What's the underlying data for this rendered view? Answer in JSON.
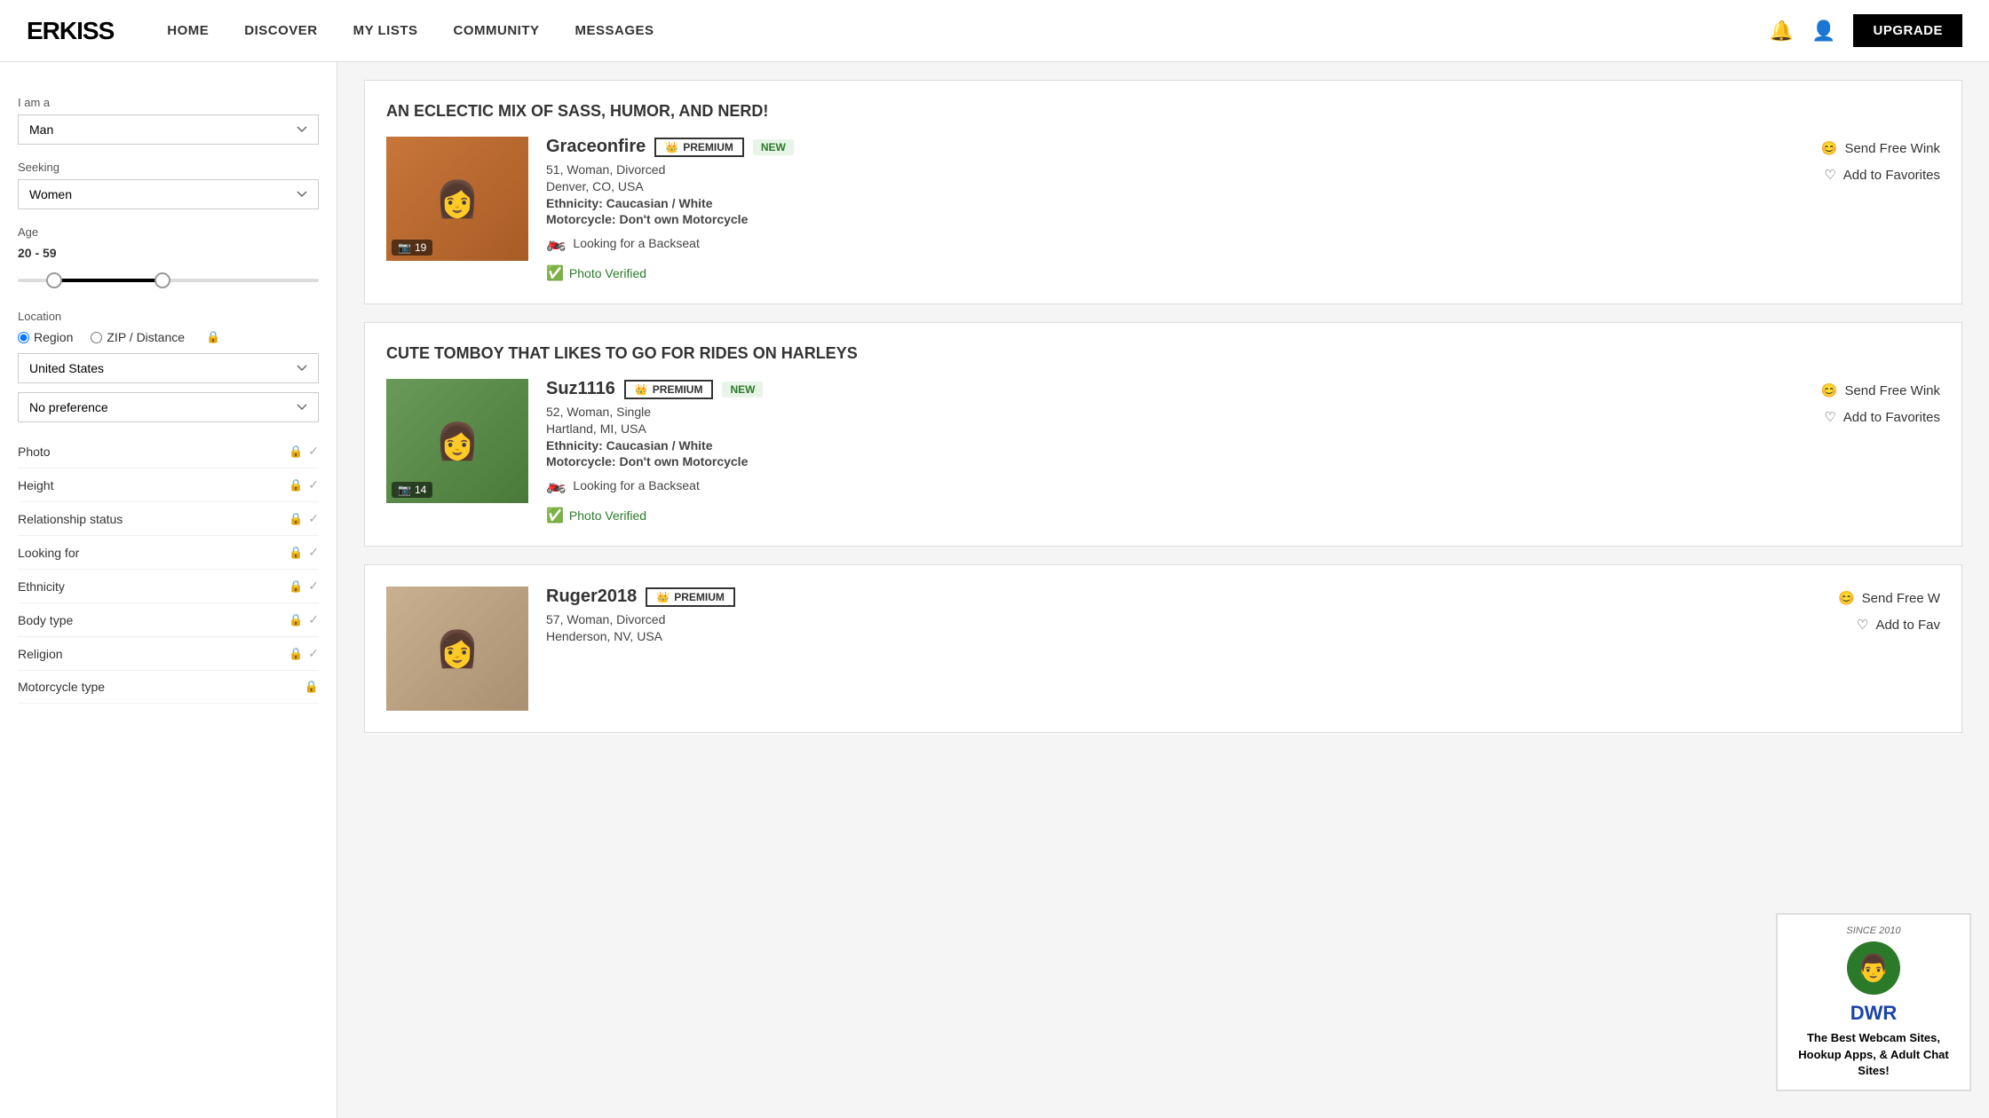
{
  "brand": "ERKISS",
  "nav": {
    "links": [
      "HOME",
      "DISCOVER",
      "MY LISTS",
      "COMMUNITY",
      "MESSAGES"
    ],
    "upgrade_label": "UPGRADE"
  },
  "sidebar": {
    "i_am_label": "I am a",
    "i_am_value": "Man",
    "seeking_label": "Seeking",
    "seeking_value": "Women",
    "age_label": "Age",
    "age_range": "20 - 59",
    "location_label": "Location",
    "region_label": "Region",
    "zip_label": "ZIP / Distance",
    "country_value": "United States",
    "no_preference": "No preference",
    "filters": [
      {
        "label": "Photo"
      },
      {
        "label": "Height"
      },
      {
        "label": "Relationship status"
      },
      {
        "label": "Looking for"
      },
      {
        "label": "Ethnicity"
      },
      {
        "label": "Body type"
      },
      {
        "label": "Religion"
      },
      {
        "label": "Motorcycle type"
      }
    ]
  },
  "profiles": [
    {
      "title": "AN ECLECTIC MIX OF SASS, HUMOR, AND NERD!",
      "name": "Graceonfire",
      "badge": "PREMIUM",
      "is_new": true,
      "details": "51, Woman, Divorced",
      "location": "Denver, CO, USA",
      "ethnicity": "Caucasian / White",
      "motorcycle": "Don't own Motorcycle",
      "looking_for": "Looking for a Backseat",
      "photo_count": "19",
      "photo_verified": "Photo Verified",
      "send_wink": "Send Free Wink",
      "add_favorites": "Add to Favorites"
    },
    {
      "title": "CUTE TOMBOY THAT LIKES TO GO FOR RIDES ON HARLEYS",
      "name": "Suz1116",
      "badge": "PREMIUM",
      "is_new": true,
      "details": "52, Woman, Single",
      "location": "Hartland, MI, USA",
      "ethnicity": "Caucasian / White",
      "motorcycle": "Don't own Motorcycle",
      "looking_for": "Looking for a Backseat",
      "photo_count": "14",
      "photo_verified": "Photo Verified",
      "send_wink": "Send Free Wink",
      "add_favorites": "Add to Favorites"
    },
    {
      "title": "",
      "name": "Ruger2018",
      "badge": "PREMIUM",
      "is_new": false,
      "details": "57, Woman, Divorced",
      "location": "Henderson, NV, USA",
      "ethnicity": "",
      "motorcycle": "",
      "looking_for": "",
      "photo_count": "",
      "photo_verified": "",
      "send_wink": "Send Free W",
      "add_favorites": "Add to Fav"
    }
  ],
  "dwr": {
    "since": "SINCE 2010",
    "logo": "DWR",
    "tagline": "The Best Webcam Sites, Hookup Apps, & Adult Chat Sites!"
  }
}
